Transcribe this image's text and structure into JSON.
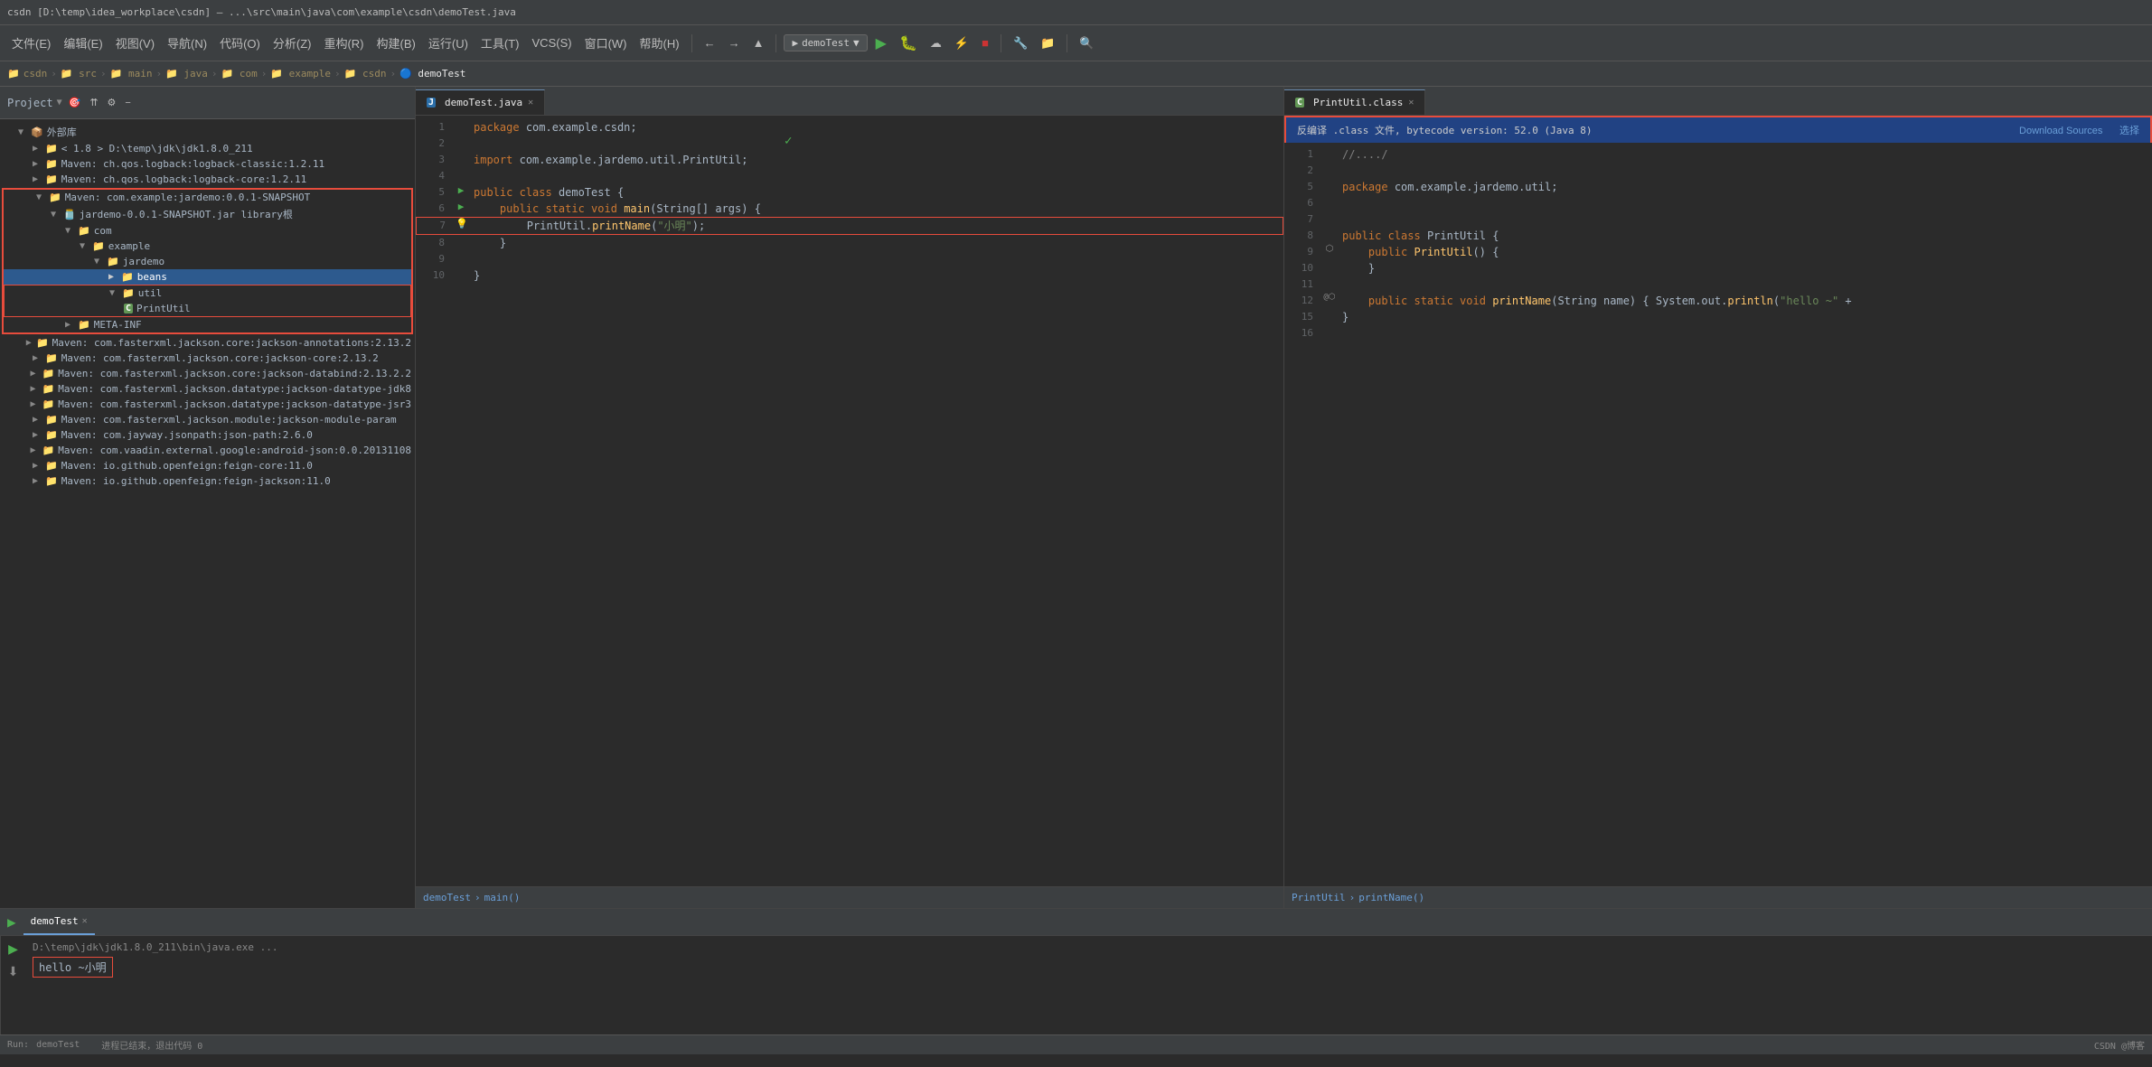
{
  "titlebar": {
    "text": "csdn [D:\\temp\\idea_workplace\\csdn] – ...\\src\\main\\java\\com\\example\\csdn\\demoTest.java"
  },
  "toolbar": {
    "run_config": "demoTest",
    "buttons": [
      "⟳",
      "⬅",
      "➡",
      "▲",
      "⊞",
      "▶",
      "⬛",
      "⌛",
      "↺",
      "📌",
      "🔍",
      "🔧",
      "📁",
      "⚙",
      "🔎"
    ]
  },
  "breadcrumb": {
    "items": [
      "csdn",
      "src",
      "main",
      "java",
      "com",
      "example",
      "csdn",
      "demoTest"
    ]
  },
  "sidebar": {
    "title": "Project",
    "items": [
      {
        "label": "外部库",
        "indent": 0,
        "expanded": true,
        "type": "folder"
      },
      {
        "label": "< 1.8 > D:\\temp\\jdk\\jdk1.8.0_211",
        "indent": 1,
        "type": "folder"
      },
      {
        "label": "Maven: ch.qos.logback:logback-classic:1.2.11",
        "indent": 1,
        "type": "folder"
      },
      {
        "label": "Maven: ch.qos.logback:logback-core:1.2.11",
        "indent": 1,
        "type": "folder"
      },
      {
        "label": "Maven: com.example:jardemo:0.0.1-SNAPSHOT",
        "indent": 1,
        "type": "folder",
        "highlighted": true,
        "expanded": true
      },
      {
        "label": "jardemo-0.0.1-SNAPSHOT.jar library根",
        "indent": 2,
        "type": "jar",
        "expanded": true
      },
      {
        "label": "com",
        "indent": 3,
        "type": "folder",
        "expanded": true
      },
      {
        "label": "example",
        "indent": 4,
        "type": "folder",
        "expanded": true
      },
      {
        "label": "jardemo",
        "indent": 5,
        "type": "folder",
        "expanded": true
      },
      {
        "label": "beans",
        "indent": 6,
        "type": "folder"
      },
      {
        "label": "util",
        "indent": 6,
        "type": "folder",
        "expanded": true,
        "highlighted": true
      },
      {
        "label": "PrintUtil",
        "indent": 7,
        "type": "class",
        "highlighted": true
      },
      {
        "label": "META-INF",
        "indent": 3,
        "type": "folder"
      },
      {
        "label": "Maven: com.fasterxml.jackson.core:jackson-annotations:2.13.2",
        "indent": 1,
        "type": "folder"
      },
      {
        "label": "Maven: com.fasterxml.jackson.core:jackson-core:2.13.2",
        "indent": 1,
        "type": "folder"
      },
      {
        "label": "Maven: com.fasterxml.jackson.core:jackson-databind:2.13.2.2",
        "indent": 1,
        "type": "folder"
      },
      {
        "label": "Maven: com.fasterxml.jackson.datatype:jackson-datatype-jdk8",
        "indent": 1,
        "type": "folder"
      },
      {
        "label": "Maven: com.fasterxml.jackson.datatype:jackson-datatype-jsr3",
        "indent": 1,
        "type": "folder"
      },
      {
        "label": "Maven: com.fasterxml.jackson.module:jackson-module-param",
        "indent": 1,
        "type": "folder"
      },
      {
        "label": "Maven: com.jayway.jsonpath:json-path:2.6.0",
        "indent": 1,
        "type": "folder"
      },
      {
        "label": "Maven: com.vaadin.external.google:android-json:0.0.20131108",
        "indent": 1,
        "type": "folder"
      },
      {
        "label": "Maven: io.github.openfeign:feign-core:11.0",
        "indent": 1,
        "type": "folder"
      },
      {
        "label": "Maven: io.github.openfeign:feign-jackson:11.0",
        "indent": 1,
        "type": "folder"
      }
    ]
  },
  "editor_tabs": {
    "left": {
      "label": "demoTest.java",
      "active": true,
      "icon": "java"
    },
    "right": {
      "label": "PrintUtil.class",
      "active": true,
      "icon": "class"
    }
  },
  "decompile_banner": {
    "message": "反编译 .class 文件, bytecode version: 52.0 (Java 8)",
    "download_label": "Download Sources",
    "choose_label": "选择"
  },
  "left_editor": {
    "filename": "demoTest.java",
    "lines": [
      {
        "num": 1,
        "content": "package com.example.csdn;",
        "gutter": ""
      },
      {
        "num": 2,
        "content": "",
        "gutter": ""
      },
      {
        "num": 3,
        "content": "import com.example.jardemo.util.PrintUtil;",
        "gutter": ""
      },
      {
        "num": 4,
        "content": "",
        "gutter": ""
      },
      {
        "num": 5,
        "content": "public class demoTest {",
        "gutter": "▶"
      },
      {
        "num": 6,
        "content": "    public static void main(String[] args) {",
        "gutter": "▶"
      },
      {
        "num": 7,
        "content": "        PrintUtil.printName(\"小明\");",
        "gutter": "💡",
        "highlighted": true
      },
      {
        "num": 8,
        "content": "    }",
        "gutter": ""
      },
      {
        "num": 9,
        "content": "",
        "gutter": ""
      },
      {
        "num": 10,
        "content": "}",
        "gutter": ""
      }
    ],
    "breadcrumb": "demoTest > main()"
  },
  "right_editor": {
    "filename": "PrintUtil.class",
    "lines": [
      {
        "num": 1,
        "content": "//..../",
        "gutter": ""
      },
      {
        "num": 2,
        "content": "",
        "gutter": ""
      },
      {
        "num": 5,
        "content": "package com.example.jardemo.util;",
        "gutter": ""
      },
      {
        "num": 6,
        "content": "",
        "gutter": ""
      },
      {
        "num": 7,
        "content": "",
        "gutter": ""
      },
      {
        "num": 8,
        "content": "public class PrintUtil {",
        "gutter": ""
      },
      {
        "num": 9,
        "content": "    public PrintUtil() {",
        "gutter": "⬡"
      },
      {
        "num": 10,
        "content": "    }",
        "gutter": ""
      },
      {
        "num": 11,
        "content": "",
        "gutter": ""
      },
      {
        "num": 12,
        "content": "    public static void printName(String name) { System.out.println(\"hello ~\" +",
        "gutter": "@⬡",
        "annotation": true
      },
      {
        "num": 15,
        "content": "}",
        "gutter": ""
      },
      {
        "num": 16,
        "content": "",
        "gutter": ""
      }
    ],
    "breadcrumb": "PrintUtil > printName()"
  },
  "run_panel": {
    "tab_label": "demoTest",
    "cmd_line": "D:\\temp\\jdk\\jdk1.8.0_211\\bin\\java.exe ...",
    "output": "hello ~小明",
    "status": "进程已结束，退出代码 0",
    "side_buttons": [
      "▶",
      "⬇"
    ]
  },
  "status_bar": {
    "left": "Run:",
    "right_items": [
      "CSDN @博客",
      ""
    ]
  }
}
